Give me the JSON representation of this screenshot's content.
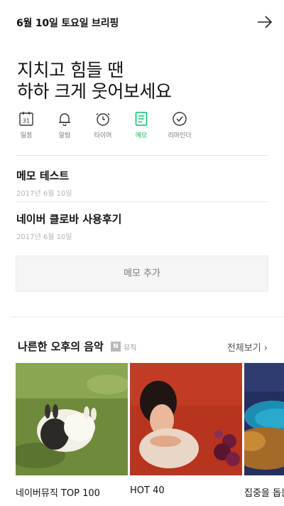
{
  "header": {
    "title": "6월 10일 토요일 브리핑",
    "arrow_icon": "arrow-right-icon"
  },
  "greeting": {
    "line1": "지치고 힘들 땐",
    "line2": "하하 크게 웃어보세요"
  },
  "tabs": [
    {
      "label": "일정",
      "icon": "calendar-icon",
      "badge": "31",
      "active": false
    },
    {
      "label": "알람",
      "icon": "bell-icon",
      "active": false
    },
    {
      "label": "타이머",
      "icon": "timer-icon",
      "active": false
    },
    {
      "label": "메모",
      "icon": "memo-icon",
      "active": true
    },
    {
      "label": "리마인더",
      "icon": "check-circle-icon",
      "active": false
    }
  ],
  "memos": [
    {
      "title": "메모 테스트",
      "date": "2017년 6월 10일"
    },
    {
      "title": "네이버 클로바 사용후기",
      "date": "2017년 6월 10일"
    }
  ],
  "add_memo_label": "메모 추가",
  "music": {
    "title": "나른한 오후의 음악",
    "badge": "N",
    "badge_label": "뮤직",
    "see_all": "전체보기 ›",
    "albums": [
      {
        "label": "네이버뮤직 TOP 100"
      },
      {
        "label": "HOT 40"
      },
      {
        "label": "집중을 돕는"
      }
    ]
  },
  "colors": {
    "accent": "#00c265",
    "text": "#111111",
    "muted": "#777777",
    "date": "#b3b3b3"
  }
}
